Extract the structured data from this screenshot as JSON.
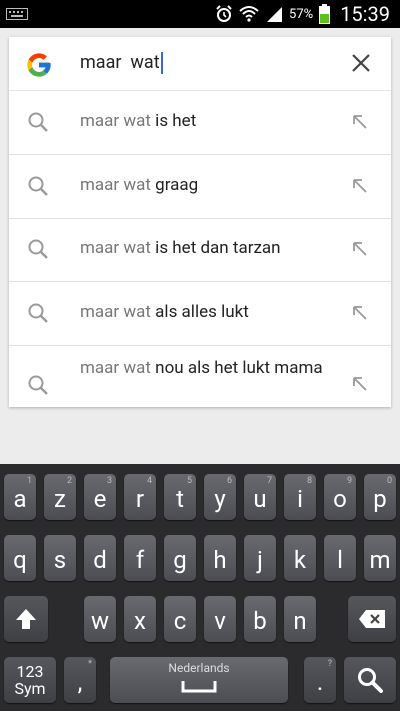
{
  "status": {
    "battery": "57%",
    "time": "15:39"
  },
  "search": {
    "query": "maar  wat"
  },
  "suggestions": [
    {
      "prefix": "maar wat",
      "suffix": " is het"
    },
    {
      "prefix": "maar wat",
      "suffix": " graag"
    },
    {
      "prefix": "maar wat",
      "suffix": " is het dan tarzan"
    },
    {
      "prefix": "maar wat",
      "suffix": " als alles lukt"
    },
    {
      "prefix": "maar wat",
      "suffix": " nou als het lukt mama"
    }
  ],
  "keyboard": {
    "row1": [
      {
        "k": "a",
        "h": "1"
      },
      {
        "k": "z",
        "h": "2"
      },
      {
        "k": "e",
        "h": "3"
      },
      {
        "k": "r",
        "h": "4"
      },
      {
        "k": "t",
        "h": "5"
      },
      {
        "k": "y",
        "h": "6"
      },
      {
        "k": "u",
        "h": "7"
      },
      {
        "k": "i",
        "h": "8"
      },
      {
        "k": "o",
        "h": "9"
      },
      {
        "k": "p",
        "h": "0"
      }
    ],
    "row2": [
      "q",
      "s",
      "d",
      "f",
      "g",
      "h",
      "j",
      "k",
      "l",
      "m"
    ],
    "row3": [
      "w",
      "x",
      "c",
      "v",
      "b",
      "n"
    ],
    "sym_label": "123\nSym",
    "space_label": "Nederlands",
    "comma_hint": "*",
    "period_hint": "?"
  }
}
